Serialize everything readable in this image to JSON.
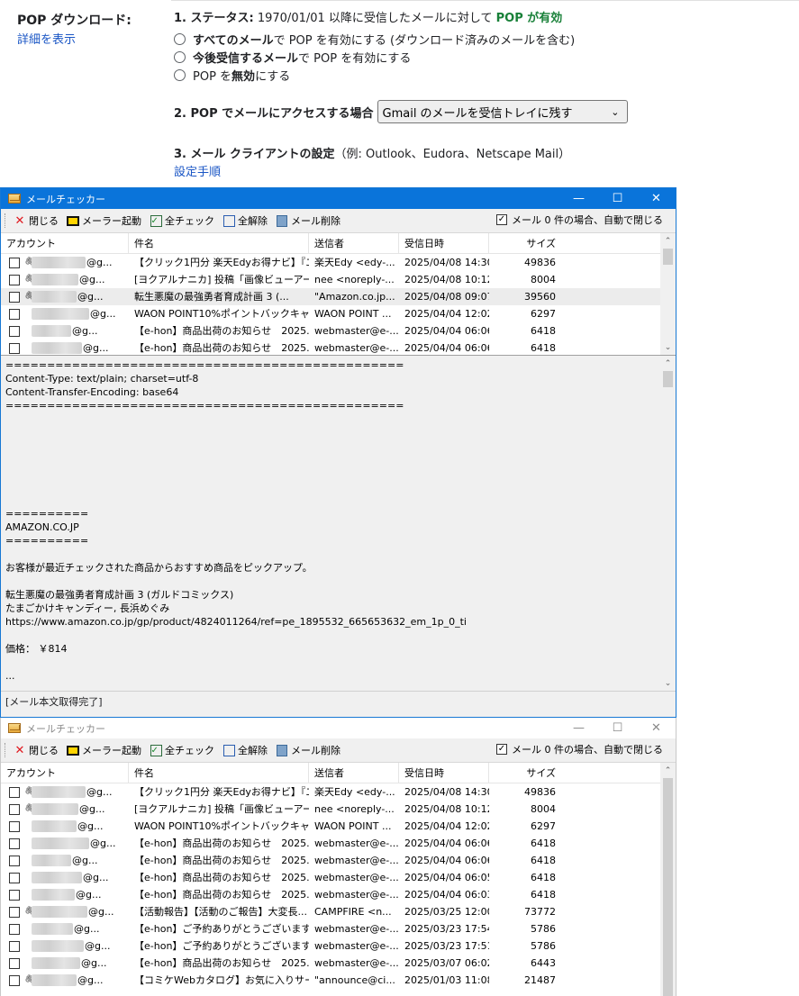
{
  "gmail": {
    "section_title": "POP ダウンロード:",
    "details_link": "詳細を表示",
    "status_label": "1. ステータス:",
    "status_text": " 1970/01/01 以降に受信したメールに対して ",
    "status_value": "POP が有効",
    "radio_options": [
      {
        "bold": "すべてのメール",
        "rest": "で POP を有効にする (ダウンロード済みのメールを含む)"
      },
      {
        "bold": "今後受信するメール",
        "rest": "で POP を有効にする"
      },
      {
        "pre": "POP を",
        "bold": "無効",
        "rest": "にする"
      }
    ],
    "access_label": "2. POP でメールにアクセスする場合",
    "access_select": "Gmail のメールを受信トレイに残す",
    "client_label": "3. メール クライアントの設定",
    "client_examples": "（例: Outlook、Eudora、Netscape Mail）",
    "setup_link": "設定手順"
  },
  "window_common": {
    "title": "メールチェッカー",
    "minimize": "—",
    "maximize": "☐",
    "close": "✕",
    "toolbar": {
      "close": "閉じる",
      "launch_mailer": "メーラー起動",
      "check_all": "全チェック",
      "uncheck_all": "全解除",
      "delete_mail": "メール削除",
      "auto_close": "メール 0 件の場合、自動で閉じる"
    },
    "columns": {
      "account": "アカウント",
      "subject": "件名",
      "sender": "送信者",
      "date": "受信日時",
      "size": "サイズ"
    }
  },
  "window1": {
    "rows": [
      {
        "clip": true,
        "account": "@g...",
        "subject": "【クリック1円分 楽天Edyお得ナビ】『エ...",
        "sender": "楽天Edy <edy-...",
        "date": "2025/04/08 14:30",
        "size": "49836"
      },
      {
        "clip": true,
        "account": "@g...",
        "subject": "[ヨクアルナニカ] 投稿「画像ビューアー「...",
        "sender": "nee <noreply-...",
        "date": "2025/04/08 10:12",
        "size": "8004"
      },
      {
        "clip": true,
        "account": "@g...",
        "subject": "転生悪魔の最強勇者育成計画 3 (...",
        "sender": "\"Amazon.co.jp...",
        "date": "2025/04/08 09:07",
        "size": "39560",
        "selected": true
      },
      {
        "clip": false,
        "account": "@g...",
        "subject": "WAON POINT10%ポイントバックキャ...",
        "sender": "WAON POINT ...",
        "date": "2025/04/04 12:02",
        "size": "6297"
      },
      {
        "clip": false,
        "account": "@g...",
        "subject": "【e-hon】商品出荷のお知らせ　2025...",
        "sender": "webmaster@e-...",
        "date": "2025/04/04 06:06",
        "size": "6418"
      },
      {
        "clip": false,
        "account": "@g...",
        "subject": "【e-hon】商品出荷のお知らせ　2025...",
        "sender": "webmaster@e-...",
        "date": "2025/04/04 06:06",
        "size": "6418"
      }
    ],
    "body": "================================================\nContent-Type: text/plain; charset=utf-8\nContent-Transfer-Encoding: base64\n================================================\n\n\n\n\n\n\n\n==========\nAMAZON.CO.JP\n==========\n\nお客様が最近チェックされた商品からおすすめ商品をピックアップ。\n\n転生悪魔の最強勇者育成計画 3 (ガルドコミックス)\nたまごかけキャンディー, 長浜めぐみ\nhttps://www.amazon.co.jp/gp/product/4824011264/ref=pe_1895532_665653632_em_1p_0_ti\n\n価格： ￥814\n\n...\n\n==========\nAmazon.co.jp",
    "status": "[メール本文取得完了]"
  },
  "window2": {
    "rows": [
      {
        "clip": true,
        "account": "@g...",
        "subject": "【クリック1円分 楽天Edyお得ナビ】『エ...",
        "sender": "楽天Edy <edy-...",
        "date": "2025/04/08 14:30",
        "size": "49836"
      },
      {
        "clip": true,
        "account": "@g...",
        "subject": "[ヨクアルナニカ] 投稿「画像ビューアー「...",
        "sender": "nee <noreply-...",
        "date": "2025/04/08 10:12",
        "size": "8004"
      },
      {
        "clip": false,
        "account": "@g...",
        "subject": "WAON POINT10%ポイントバックキャ...",
        "sender": "WAON POINT ...",
        "date": "2025/04/04 12:02",
        "size": "6297"
      },
      {
        "clip": false,
        "account": "@g...",
        "subject": "【e-hon】商品出荷のお知らせ　2025...",
        "sender": "webmaster@e-...",
        "date": "2025/04/04 06:06",
        "size": "6418"
      },
      {
        "clip": false,
        "account": "@g...",
        "subject": "【e-hon】商品出荷のお知らせ　2025...",
        "sender": "webmaster@e-...",
        "date": "2025/04/04 06:06",
        "size": "6418"
      },
      {
        "clip": false,
        "account": "@g...",
        "subject": "【e-hon】商品出荷のお知らせ　2025...",
        "sender": "webmaster@e-...",
        "date": "2025/04/04 06:05",
        "size": "6418"
      },
      {
        "clip": false,
        "account": "@g...",
        "subject": "【e-hon】商品出荷のお知らせ　2025...",
        "sender": "webmaster@e-...",
        "date": "2025/04/04 06:03",
        "size": "6418"
      },
      {
        "clip": true,
        "account": "@g...",
        "subject": "【活動報告】【活動のご報告】大変長...",
        "sender": "CAMPFIRE <n...",
        "date": "2025/03/25 12:00",
        "size": "73772"
      },
      {
        "clip": false,
        "account": "@g...",
        "subject": "【e-hon】ご予約ありがとうございます",
        "sender": "webmaster@e-...",
        "date": "2025/03/23 17:54",
        "size": "5786"
      },
      {
        "clip": false,
        "account": "@g...",
        "subject": "【e-hon】ご予約ありがとうございます",
        "sender": "webmaster@e-...",
        "date": "2025/03/23 17:51",
        "size": "5786"
      },
      {
        "clip": false,
        "account": "@g...",
        "subject": "【e-hon】商品出荷のお知らせ　2025...",
        "sender": "webmaster@e-...",
        "date": "2025/03/07 06:02",
        "size": "6443"
      },
      {
        "clip": true,
        "account": "@g...",
        "subject": "【コミケWebカタログ】お気に入りサーク...",
        "sender": "\"announce@ci...",
        "date": "2025/01/03 11:08",
        "size": "21487"
      }
    ]
  }
}
